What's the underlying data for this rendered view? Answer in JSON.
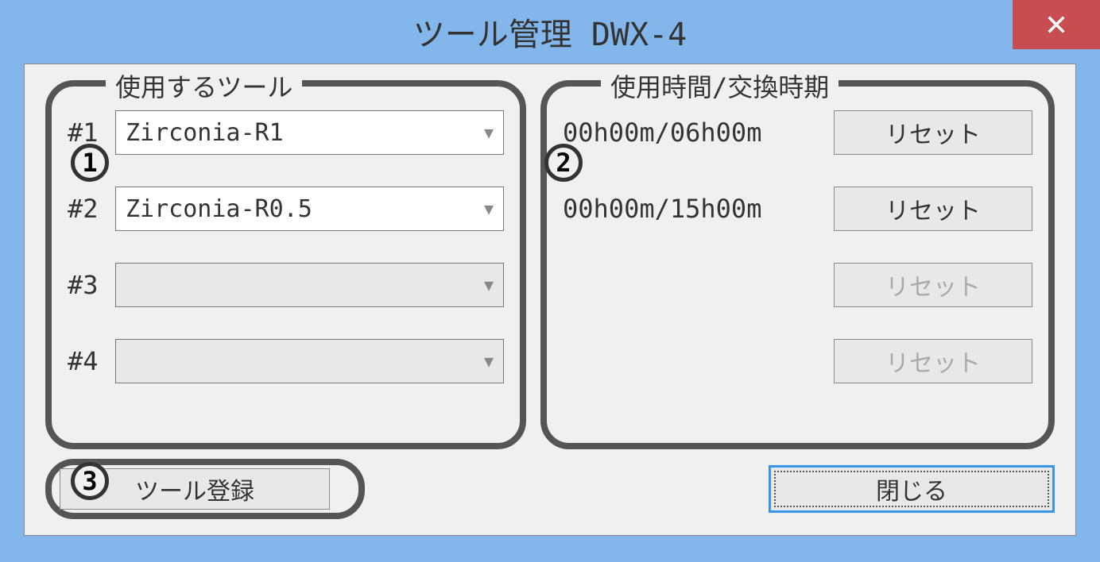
{
  "window": {
    "title": "ツール管理 DWX-4"
  },
  "annotations": {
    "num1": "1",
    "num2": "2",
    "num3": "3"
  },
  "left_panel": {
    "legend": "使用するツール",
    "rows": [
      {
        "label": "#1",
        "value": "Zirconia-R1",
        "enabled": true
      },
      {
        "label": "#2",
        "value": "Zirconia-R0.5",
        "enabled": true
      },
      {
        "label": "#3",
        "value": "",
        "enabled": false
      },
      {
        "label": "#4",
        "value": "",
        "enabled": false
      }
    ]
  },
  "right_panel": {
    "legend": "使用時間/交換時期",
    "rows": [
      {
        "time": "00h00m/06h00m",
        "reset_label": "リセット",
        "enabled": true
      },
      {
        "time": "00h00m/15h00m",
        "reset_label": "リセット",
        "enabled": true
      },
      {
        "time": "",
        "reset_label": "リセット",
        "enabled": false
      },
      {
        "time": "",
        "reset_label": "リセット",
        "enabled": false
      }
    ]
  },
  "buttons": {
    "tool_register": "ツール登録",
    "close": "閉じる"
  }
}
